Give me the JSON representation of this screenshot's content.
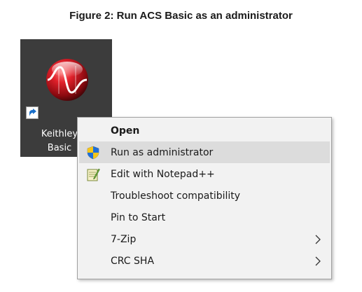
{
  "caption": "Figure 2: Run ACS Basic as an administrator",
  "desktop": {
    "icon_name": "keithley-acs-basic-icon",
    "label_line1": "Keithley",
    "label_line2": "Basic"
  },
  "context_menu": {
    "items": [
      {
        "label": "Open",
        "bold": true,
        "icon": "",
        "submenu": false,
        "highlighted": false
      },
      {
        "label": "Run as administrator",
        "bold": false,
        "icon": "uac-shield-icon",
        "submenu": false,
        "highlighted": true
      },
      {
        "label": "Edit with Notepad++",
        "bold": false,
        "icon": "notepad-plus-plus-icon",
        "submenu": false,
        "highlighted": false
      },
      {
        "label": "Troubleshoot compatibility",
        "bold": false,
        "icon": "",
        "submenu": false,
        "highlighted": false
      },
      {
        "label": "Pin to Start",
        "bold": false,
        "icon": "",
        "submenu": false,
        "highlighted": false
      },
      {
        "label": "7-Zip",
        "bold": false,
        "icon": "",
        "submenu": true,
        "highlighted": false
      },
      {
        "label": "CRC SHA",
        "bold": false,
        "icon": "",
        "submenu": true,
        "highlighted": false
      }
    ]
  },
  "colors": {
    "desktop_bg": "#3c3c3c",
    "menu_bg": "#f2f2f2",
    "highlight": "#dcdcdc",
    "icon_red": "#c8141e"
  }
}
